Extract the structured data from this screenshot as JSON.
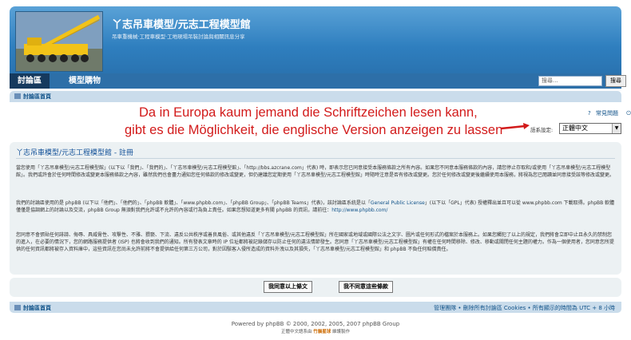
{
  "header": {
    "site_title": "丫志吊車模型/元志工程模型館",
    "site_desc": "吊車重機械‧工程車模型‧工地現場吊裝討論與相關訊息分享"
  },
  "nav": {
    "tabs": [
      "討論區",
      "模型購物"
    ],
    "search_placeholder": "搜尋...",
    "search_button": "搜尋"
  },
  "breadcrumb": {
    "label": "討論區首頁"
  },
  "annotation": {
    "line1": "Da in Europa kaum jemand die Schriftzeichen lesen kann,",
    "line2": "gibt es die Möglichkeit, die englische Version anzeigen zu lassen"
  },
  "toplinks": {
    "faq": "常見問題",
    "login": "登入"
  },
  "language": {
    "label": "語系設定:",
    "selected": "正體中文"
  },
  "panel": {
    "title": "丫志吊車模型/元志工程模型館 - 註冊",
    "para1": "當您使用「丫志吊車模型/元志工程模型館」(以下以「我們」、「我們的」、「丫志吊車模型/元志工程模型館」、「http://bbs.azcrane.com」代表) 時，即表示您已同意接受本服務條款之所有內容。如果您不同意本服務條款的內容，請您停止存取和/或使用「丫志吊車模型/元志工程模型館」。我們或許會於任何時間修改或變更本服務條款之內容，雖然我們也會盡力通知您任何條款的修改或變更，但仍建議您定期使用「丫志吊車模型/元志工程模型館」時隨時注意是否有修改或變更。您於任何修改或變更後繼續使用本服務，將視為您已閱讀並同意接受該等修改或變更。",
    "para2a": "我們的討論區使用的是 phpBB (以下以「他們」、「他們的」、「phpBB 軟體」、「www.phpbb.com」、「phpBB Group」、「phpBB Teams」代表)，該討論區系統是以「",
    "para2_link": "General Public License",
    "para2b": "」(以下以「GPL」代表) 授權釋出並且可以從 www.phpbb.com 下載取得。phpBB 軟體僅僅是協調網上的討論以及交流，phpBB Group 無須對我們允許或不允許的內容或行為負上責任。如果您想知道更多有關 phpBB 的資訊，請前往：",
    "para2_url": "http://www.phpbb.com/",
    "para3": "您同意不會張貼任何誹謗、侮辱、具威脅性、攻擊性、不雅、猥褻、下流、違反公共秩序或善良風俗、或其他違反「丫志吊車模型/元志工程模型館」所在國家或地域或國際公法之文字、圖片或任何形式的檔案於本服務上。如果您觸犯了以上的規定，我們將會立即中止且永久的禁制您的進入，在必要的情況下，您的網路服務提供者 (ISP) 也將會收到我們的通知。所有發表文章時的 IP 位址都將被記錄儲存以防止任何的違法情節發生。您同意「丫志吊車模型/元志工程模型館」有權在任何時間移除、修改、移動或關閉任何主題的權力。作為一個使用者，您同意您所提供的任何資訊都將被存入資料庫中，這些資訊在您尚未允許前將不會提供給任何第三方公司，對於因駭客入侵所造成的資料外洩以及其損失，「丫志吊車模型/元志工程模型館」和 phpBB 不負任何賠償責任。"
  },
  "buttons": {
    "agree": "我同意以上條文",
    "disagree": "我不同意這些條款"
  },
  "footer": {
    "left": "討論區首頁",
    "right": "管理團隊 • 刪除所有討論區 Cookies • 所有顯示的時間為 UTC + 8 小時"
  },
  "powered": "Powered by phpBB © 2000, 2002, 2005, 2007 phpBB Group",
  "translated": {
    "prefix": "正體中文語系由",
    "highlight": "竹貓星球",
    "suffix": "維護製作"
  },
  "colors": {
    "annotation": "#d21a1a",
    "header": "#2f7fbf",
    "nav": "#2d6fa8",
    "panel": "#ecf1f3"
  },
  "icons": [
    "home-icon",
    "faq-icon",
    "login-icon",
    "crane-logo",
    "red-arrow-icon",
    "dropdown-arrow-icon"
  ]
}
